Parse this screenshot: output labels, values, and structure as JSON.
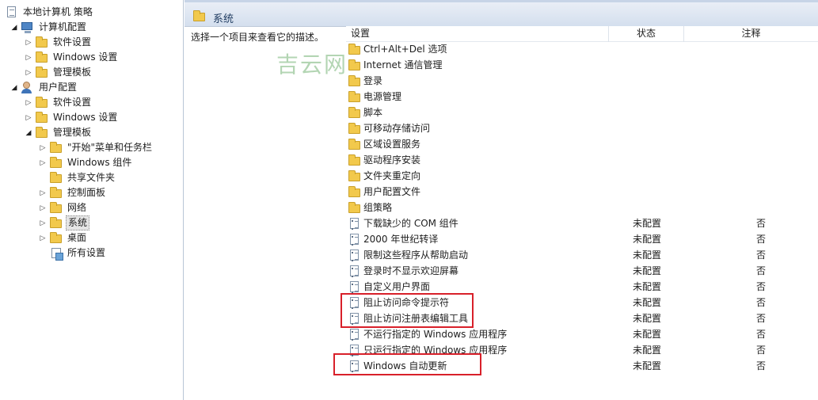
{
  "tree": [
    {
      "label": "本地计算机 策略",
      "icon": "policy-doc-icon",
      "level": 0,
      "arrow": "",
      "selected": false
    },
    {
      "label": "计算机配置",
      "icon": "computer-icon",
      "level": 1,
      "arrow": "open",
      "selected": false
    },
    {
      "label": "软件设置",
      "icon": "folder-icon",
      "level": 2,
      "arrow": "closed",
      "selected": false
    },
    {
      "label": "Windows 设置",
      "icon": "folder-icon",
      "level": 2,
      "arrow": "closed",
      "selected": false
    },
    {
      "label": "管理模板",
      "icon": "folder-icon",
      "level": 2,
      "arrow": "closed",
      "selected": false
    },
    {
      "label": "用户配置",
      "icon": "user-icon",
      "level": 1,
      "arrow": "open",
      "selected": false
    },
    {
      "label": "软件设置",
      "icon": "folder-icon",
      "level": 2,
      "arrow": "closed",
      "selected": false
    },
    {
      "label": "Windows 设置",
      "icon": "folder-icon",
      "level": 2,
      "arrow": "closed",
      "selected": false
    },
    {
      "label": "管理模板",
      "icon": "folder-icon",
      "level": 2,
      "arrow": "open",
      "selected": false
    },
    {
      "label": "\"开始\"菜单和任务栏",
      "icon": "folder-icon",
      "level": 3,
      "arrow": "closed",
      "selected": false
    },
    {
      "label": "Windows 组件",
      "icon": "folder-icon",
      "level": 3,
      "arrow": "closed",
      "selected": false
    },
    {
      "label": "共享文件夹",
      "icon": "folder-icon",
      "level": 3,
      "arrow": "",
      "selected": false
    },
    {
      "label": "控制面板",
      "icon": "folder-icon",
      "level": 3,
      "arrow": "closed",
      "selected": false
    },
    {
      "label": "网络",
      "icon": "folder-icon",
      "level": 3,
      "arrow": "closed",
      "selected": false
    },
    {
      "label": "系统",
      "icon": "folder-icon",
      "level": 3,
      "arrow": "closed",
      "selected": true
    },
    {
      "label": "桌面",
      "icon": "folder-icon",
      "level": 3,
      "arrow": "closed",
      "selected": false
    },
    {
      "label": "所有设置",
      "icon": "all-settings-icon",
      "level": 3,
      "arrow": "",
      "selected": false
    }
  ],
  "header": {
    "title": "系统"
  },
  "description": "选择一个项目来查看它的描述。",
  "columns": {
    "setting": "设置",
    "state": "状态",
    "comment": "注释"
  },
  "rows": [
    {
      "name": "Ctrl+Alt+Del 选项",
      "kind": "folder",
      "state": "",
      "comment": ""
    },
    {
      "name": "Internet 通信管理",
      "kind": "folder",
      "state": "",
      "comment": ""
    },
    {
      "name": "登录",
      "kind": "folder",
      "state": "",
      "comment": ""
    },
    {
      "name": "电源管理",
      "kind": "folder",
      "state": "",
      "comment": ""
    },
    {
      "name": "脚本",
      "kind": "folder",
      "state": "",
      "comment": ""
    },
    {
      "name": "可移动存储访问",
      "kind": "folder",
      "state": "",
      "comment": ""
    },
    {
      "name": "区域设置服务",
      "kind": "folder",
      "state": "",
      "comment": ""
    },
    {
      "name": "驱动程序安装",
      "kind": "folder",
      "state": "",
      "comment": ""
    },
    {
      "name": "文件夹重定向",
      "kind": "folder",
      "state": "",
      "comment": ""
    },
    {
      "name": "用户配置文件",
      "kind": "folder",
      "state": "",
      "comment": ""
    },
    {
      "name": "组策略",
      "kind": "folder",
      "state": "",
      "comment": ""
    },
    {
      "name": "下载缺少的 COM 组件",
      "kind": "setting",
      "state": "未配置",
      "comment": "否"
    },
    {
      "name": "2000 年世纪转译",
      "kind": "setting",
      "state": "未配置",
      "comment": "否"
    },
    {
      "name": "限制这些程序从帮助启动",
      "kind": "setting",
      "state": "未配置",
      "comment": "否"
    },
    {
      "name": "登录时不显示欢迎屏幕",
      "kind": "setting",
      "state": "未配置",
      "comment": "否"
    },
    {
      "name": "自定义用户界面",
      "kind": "setting",
      "state": "未配置",
      "comment": "否"
    },
    {
      "name": "阻止访问命令提示符",
      "kind": "setting",
      "state": "未配置",
      "comment": "否"
    },
    {
      "name": "阻止访问注册表编辑工具",
      "kind": "setting",
      "state": "未配置",
      "comment": "否"
    },
    {
      "name": "不运行指定的 Windows 应用程序",
      "kind": "setting",
      "state": "未配置",
      "comment": "否"
    },
    {
      "name": "只运行指定的 Windows 应用程序",
      "kind": "setting",
      "state": "未配置",
      "comment": "否"
    },
    {
      "name": "Windows 自动更新",
      "kind": "setting",
      "state": "未配置",
      "comment": "否"
    }
  ],
  "watermark": "吉云网",
  "colors": {
    "highlight": "#d8202a",
    "header_bg": "#d4dfee",
    "selection_bg": "#e5e5e5"
  }
}
